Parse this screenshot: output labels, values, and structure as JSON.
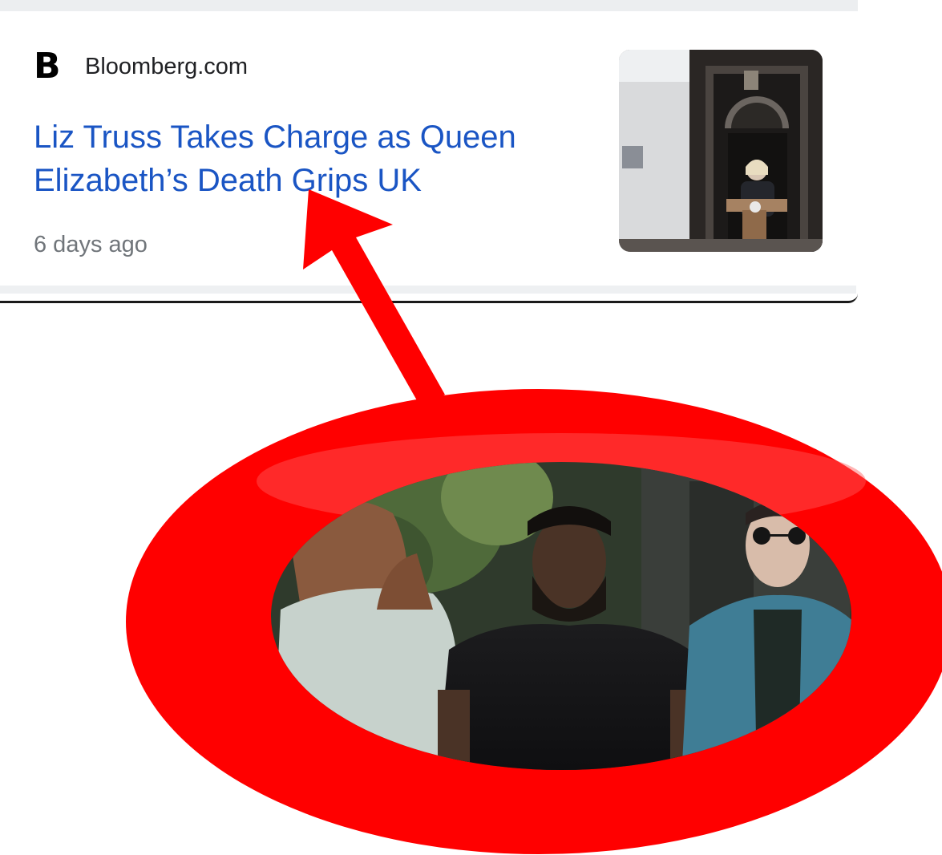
{
  "card": {
    "source_logo": "B",
    "source_name": "Bloomberg.com",
    "headline": "Liz Truss Takes Charge as Queen Elizabeth’s Death Grips UK",
    "timestamp": "6 days ago",
    "thumbnail_alt": "Press photo at Downing Street door"
  },
  "annotation": {
    "color": "#ff0000",
    "arrow": "red-arrow-pointing-at-headline",
    "circle": "red-ring-around-band-photo",
    "inset_photo_alt": "Band photo of three men outdoors"
  },
  "colors": {
    "headline_link": "#1a55c4",
    "source_text": "#202124",
    "timestamp_text": "#70757a",
    "annotation_red": "#ff0000"
  }
}
